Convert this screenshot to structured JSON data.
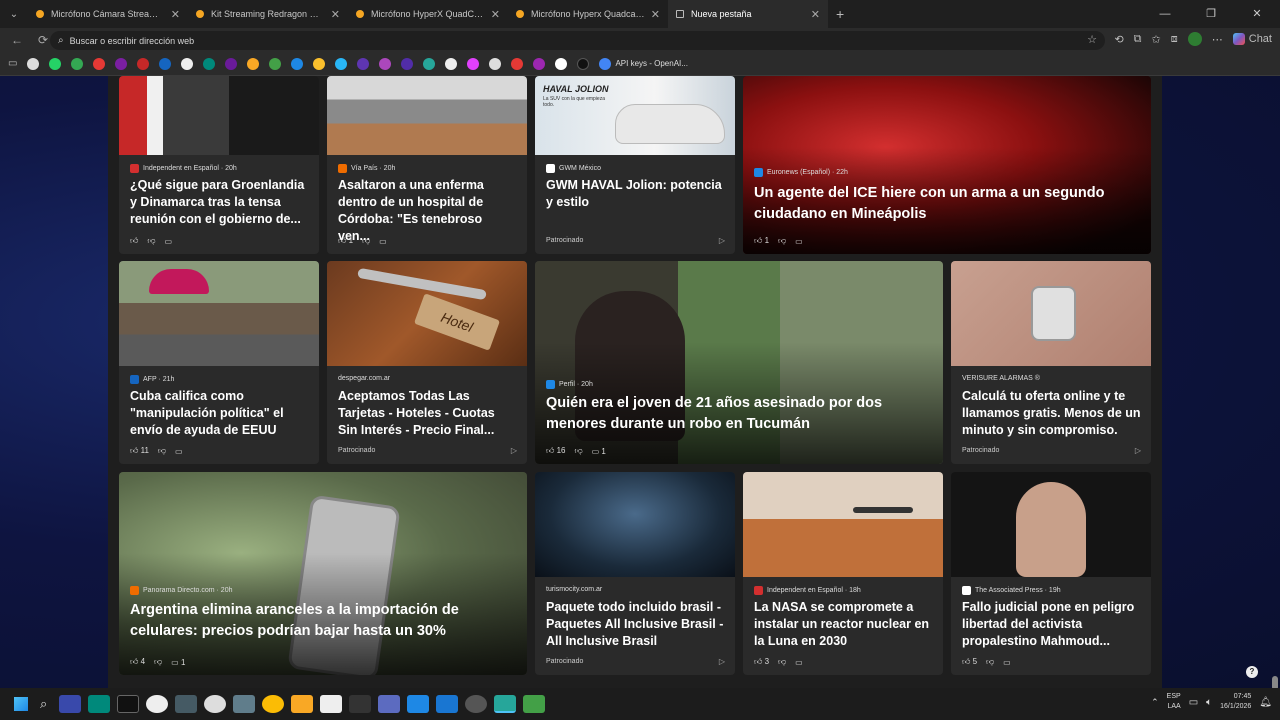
{
  "tabs": [
    {
      "title": "Micrófono Cámara Streaming | Me",
      "active": false
    },
    {
      "title": "Kit Streaming Redragon Cámara W",
      "active": false
    },
    {
      "title": "Micrófono HyperX QuadCast S RG",
      "active": false
    },
    {
      "title": "Micrófono Hyperx Quadcast 2 Usb",
      "active": false
    },
    {
      "title": "Nueva pestaña",
      "active": true
    }
  ],
  "address_bar": {
    "placeholder": "Buscar o escribir dirección web"
  },
  "bookmarks": {
    "api_keys": "API keys - OpenAI..."
  },
  "chat_label": "Chat",
  "cards": {
    "c1": {
      "source": "Independent en Español · 20h",
      "title": "¿Qué sigue para Groenlandia y Dinamarca tras la tensa reunión con el gobierno de...",
      "likes": ""
    },
    "c2": {
      "source": "Vía País · 20h",
      "title": "Asaltaron a una enferma dentro de un hospital de Córdoba: \"Es tenebroso ven...",
      "likes": "1"
    },
    "c3": {
      "source": "GWM México",
      "title": "GWM HAVAL Jolion: potencia y estilo",
      "sponsored": "Patrocinado",
      "ad_heading": "HAVAL JOLION",
      "ad_tagline": "La SUV con la que empieza todo."
    },
    "c4": {
      "source": "Euronews (Español) · 22h",
      "title": "Un agente del ICE hiere con un arma a un segundo ciudadano en Mineápolis",
      "likes": "1"
    },
    "c5": {
      "source": "AFP · 21h",
      "title": "Cuba califica como \"manipulación política\" el envío de ayuda de EEUU",
      "likes": "11"
    },
    "c6": {
      "source": "despegar.com.ar",
      "title": "Aceptamos Todas Las Tarjetas - Hoteles - Cuotas Sin Interés - Precio Final...",
      "sponsored": "Patrocinado",
      "tag": "Hotel"
    },
    "c7": {
      "source": "Perfil · 20h",
      "title": "Quién era el joven de 21 años asesinado por dos menores durante un robo en Tucumán",
      "likes": "16",
      "comments": "1"
    },
    "c8": {
      "source": "VERISURE ALARMAS ®",
      "title": "Calculá tu oferta online y te llamamos gratis. Menos de un minuto y sin compromiso.",
      "sponsored": "Patrocinado"
    },
    "c9": {
      "source": "Panorama Directo.com · 20h",
      "title": "Argentina elimina aranceles a la importación de celulares: precios podrían bajar hasta un 30%",
      "likes": "4",
      "comments": "1"
    },
    "c10": {
      "source": "turismocity.com.ar",
      "title": "Paquete todo incluido brasil - Paquetes All Inclusive Brasil - All Inclusive Brasil",
      "sponsored": "Patrocinado"
    },
    "c11": {
      "source": "Independent en Español · 18h",
      "title": "La NASA se compromete a instalar un reactor nuclear en la Luna en 2030",
      "likes": "3"
    },
    "c12": {
      "source": "The Associated Press · 19h",
      "title": "Fallo judicial pone en peligro libertad del activista propalestino Mahmoud...",
      "likes": "5"
    }
  },
  "tray": {
    "lang": "ESP",
    "region": "LAA",
    "time": "07:45",
    "date": "16/1/2026"
  }
}
